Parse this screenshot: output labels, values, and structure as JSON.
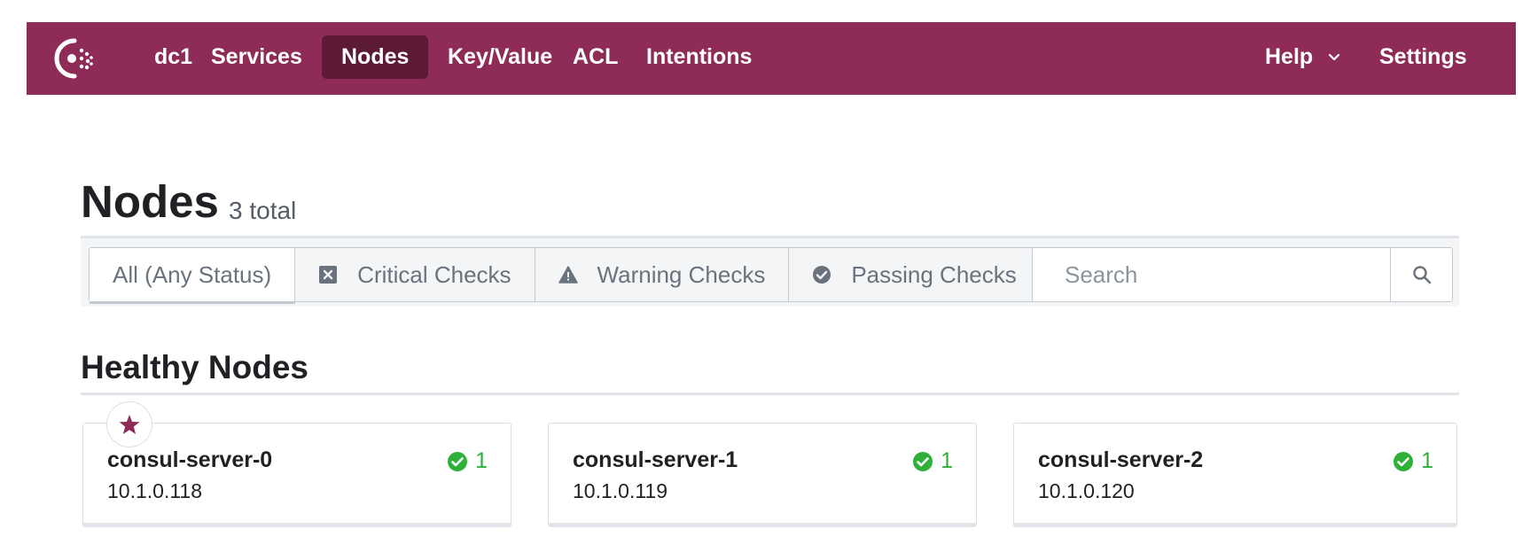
{
  "nav": {
    "items": [
      {
        "label": "dc1"
      },
      {
        "label": "Services"
      },
      {
        "label": "Nodes"
      },
      {
        "label": "Key/Value"
      },
      {
        "label": "ACL"
      },
      {
        "label": "Intentions"
      }
    ],
    "help_label": "Help",
    "settings_label": "Settings",
    "active": "Nodes",
    "brand_color": "#8e2c57"
  },
  "page": {
    "title": "Nodes",
    "total": "3 total"
  },
  "filters": {
    "items": [
      {
        "label": "All (Any Status)",
        "icon": "none",
        "selected": true
      },
      {
        "label": "Critical Checks",
        "icon": "x-square-icon"
      },
      {
        "label": "Warning Checks",
        "icon": "warning-triangle-icon"
      },
      {
        "label": "Passing Checks",
        "icon": "check-circle-icon"
      }
    ],
    "search_placeholder": "Search",
    "search_value": ""
  },
  "section": {
    "title": "Healthy Nodes"
  },
  "nodes": [
    {
      "name": "consul-server-0",
      "ip": "10.1.0.118",
      "passing": "1",
      "leader": true
    },
    {
      "name": "consul-server-1",
      "ip": "10.1.0.119",
      "passing": "1"
    },
    {
      "name": "consul-server-2",
      "ip": "10.1.0.120",
      "passing": "1"
    }
  ],
  "colors": {
    "passing": "#2eb039",
    "brand": "#8e2c57"
  }
}
